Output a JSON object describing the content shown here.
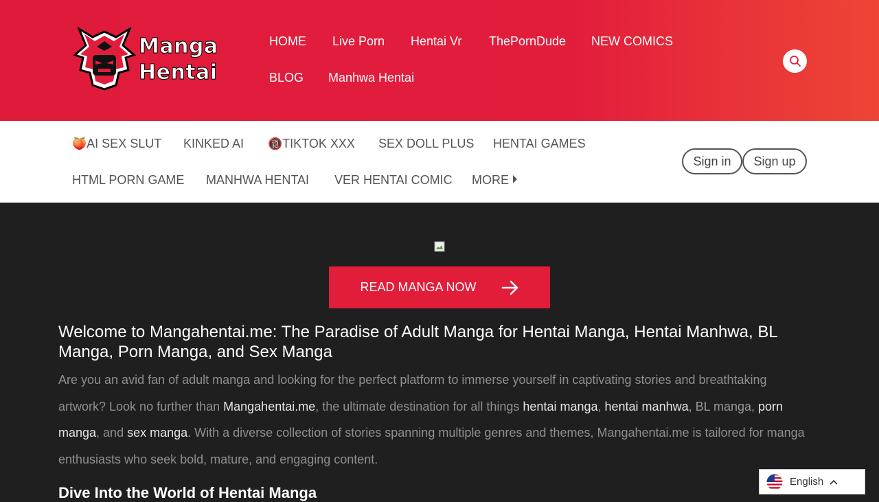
{
  "logo": {
    "line1": "Manga",
    "line2": "Hentai"
  },
  "main_nav": [
    {
      "label": "HOME"
    },
    {
      "label": "Live Porn"
    },
    {
      "label": "Hentai Vr"
    },
    {
      "label": "ThePornDude"
    },
    {
      "label": "NEW COMICS"
    },
    {
      "label": "BLOG"
    },
    {
      "label": "Manhwa Hentai"
    }
  ],
  "sub_nav": [
    {
      "label": "AI SEX SLUT",
      "emoji": "🍑"
    },
    {
      "label": "KINKED AI"
    },
    {
      "label": "TIKTOK XXX",
      "emoji": "🔞"
    },
    {
      "label": "SEX DOLL PLUS"
    },
    {
      "label": "HENTAI GAMES"
    },
    {
      "label": "HTML PORN GAME"
    },
    {
      "label": "MANHWA HENTAI"
    },
    {
      "label": "VER HENTAI COMIC"
    },
    {
      "label": "MORE"
    }
  ],
  "auth": {
    "sign_in": "Sign in",
    "sign_up": "Sign up"
  },
  "cta": {
    "label": "READ MANGA NOW"
  },
  "content": {
    "heading": "Welcome to Mangahentai.me: The Paradise of Adult Manga for Hentai Manga, Hentai Manhwa, BL Manga, Porn Manga, and Sex Manga",
    "p1": "Are you an avid fan of adult manga and looking for the perfect platform to immerse yourself in captivating stories and breathtaking artwork? Look no further than ",
    "b1": "Mangahentai.me",
    "p2": ", the ultimate destination for all things ",
    "b2": "hentai manga",
    "p3": ", ",
    "b3": "hentai manhwa",
    "p4": ", ",
    "b4": "BL manga",
    "p5": ", ",
    "b5": "porn manga",
    "p6": ", and ",
    "b6": "sex manga",
    "p7": ". With a diverse collection of stories spanning multiple genres and themes, Mangahentai.me is tailored for manga enthusiasts who seek bold, mature, and engaging content.",
    "heading2": "Dive Into the World of Hentai Manga"
  },
  "language": {
    "label": "English"
  },
  "colors": {
    "header_red": "#e21d3c",
    "cta_red": "#e11d39",
    "body_bg": "#1f1f1f",
    "subbar_bg": "#ffffff"
  }
}
